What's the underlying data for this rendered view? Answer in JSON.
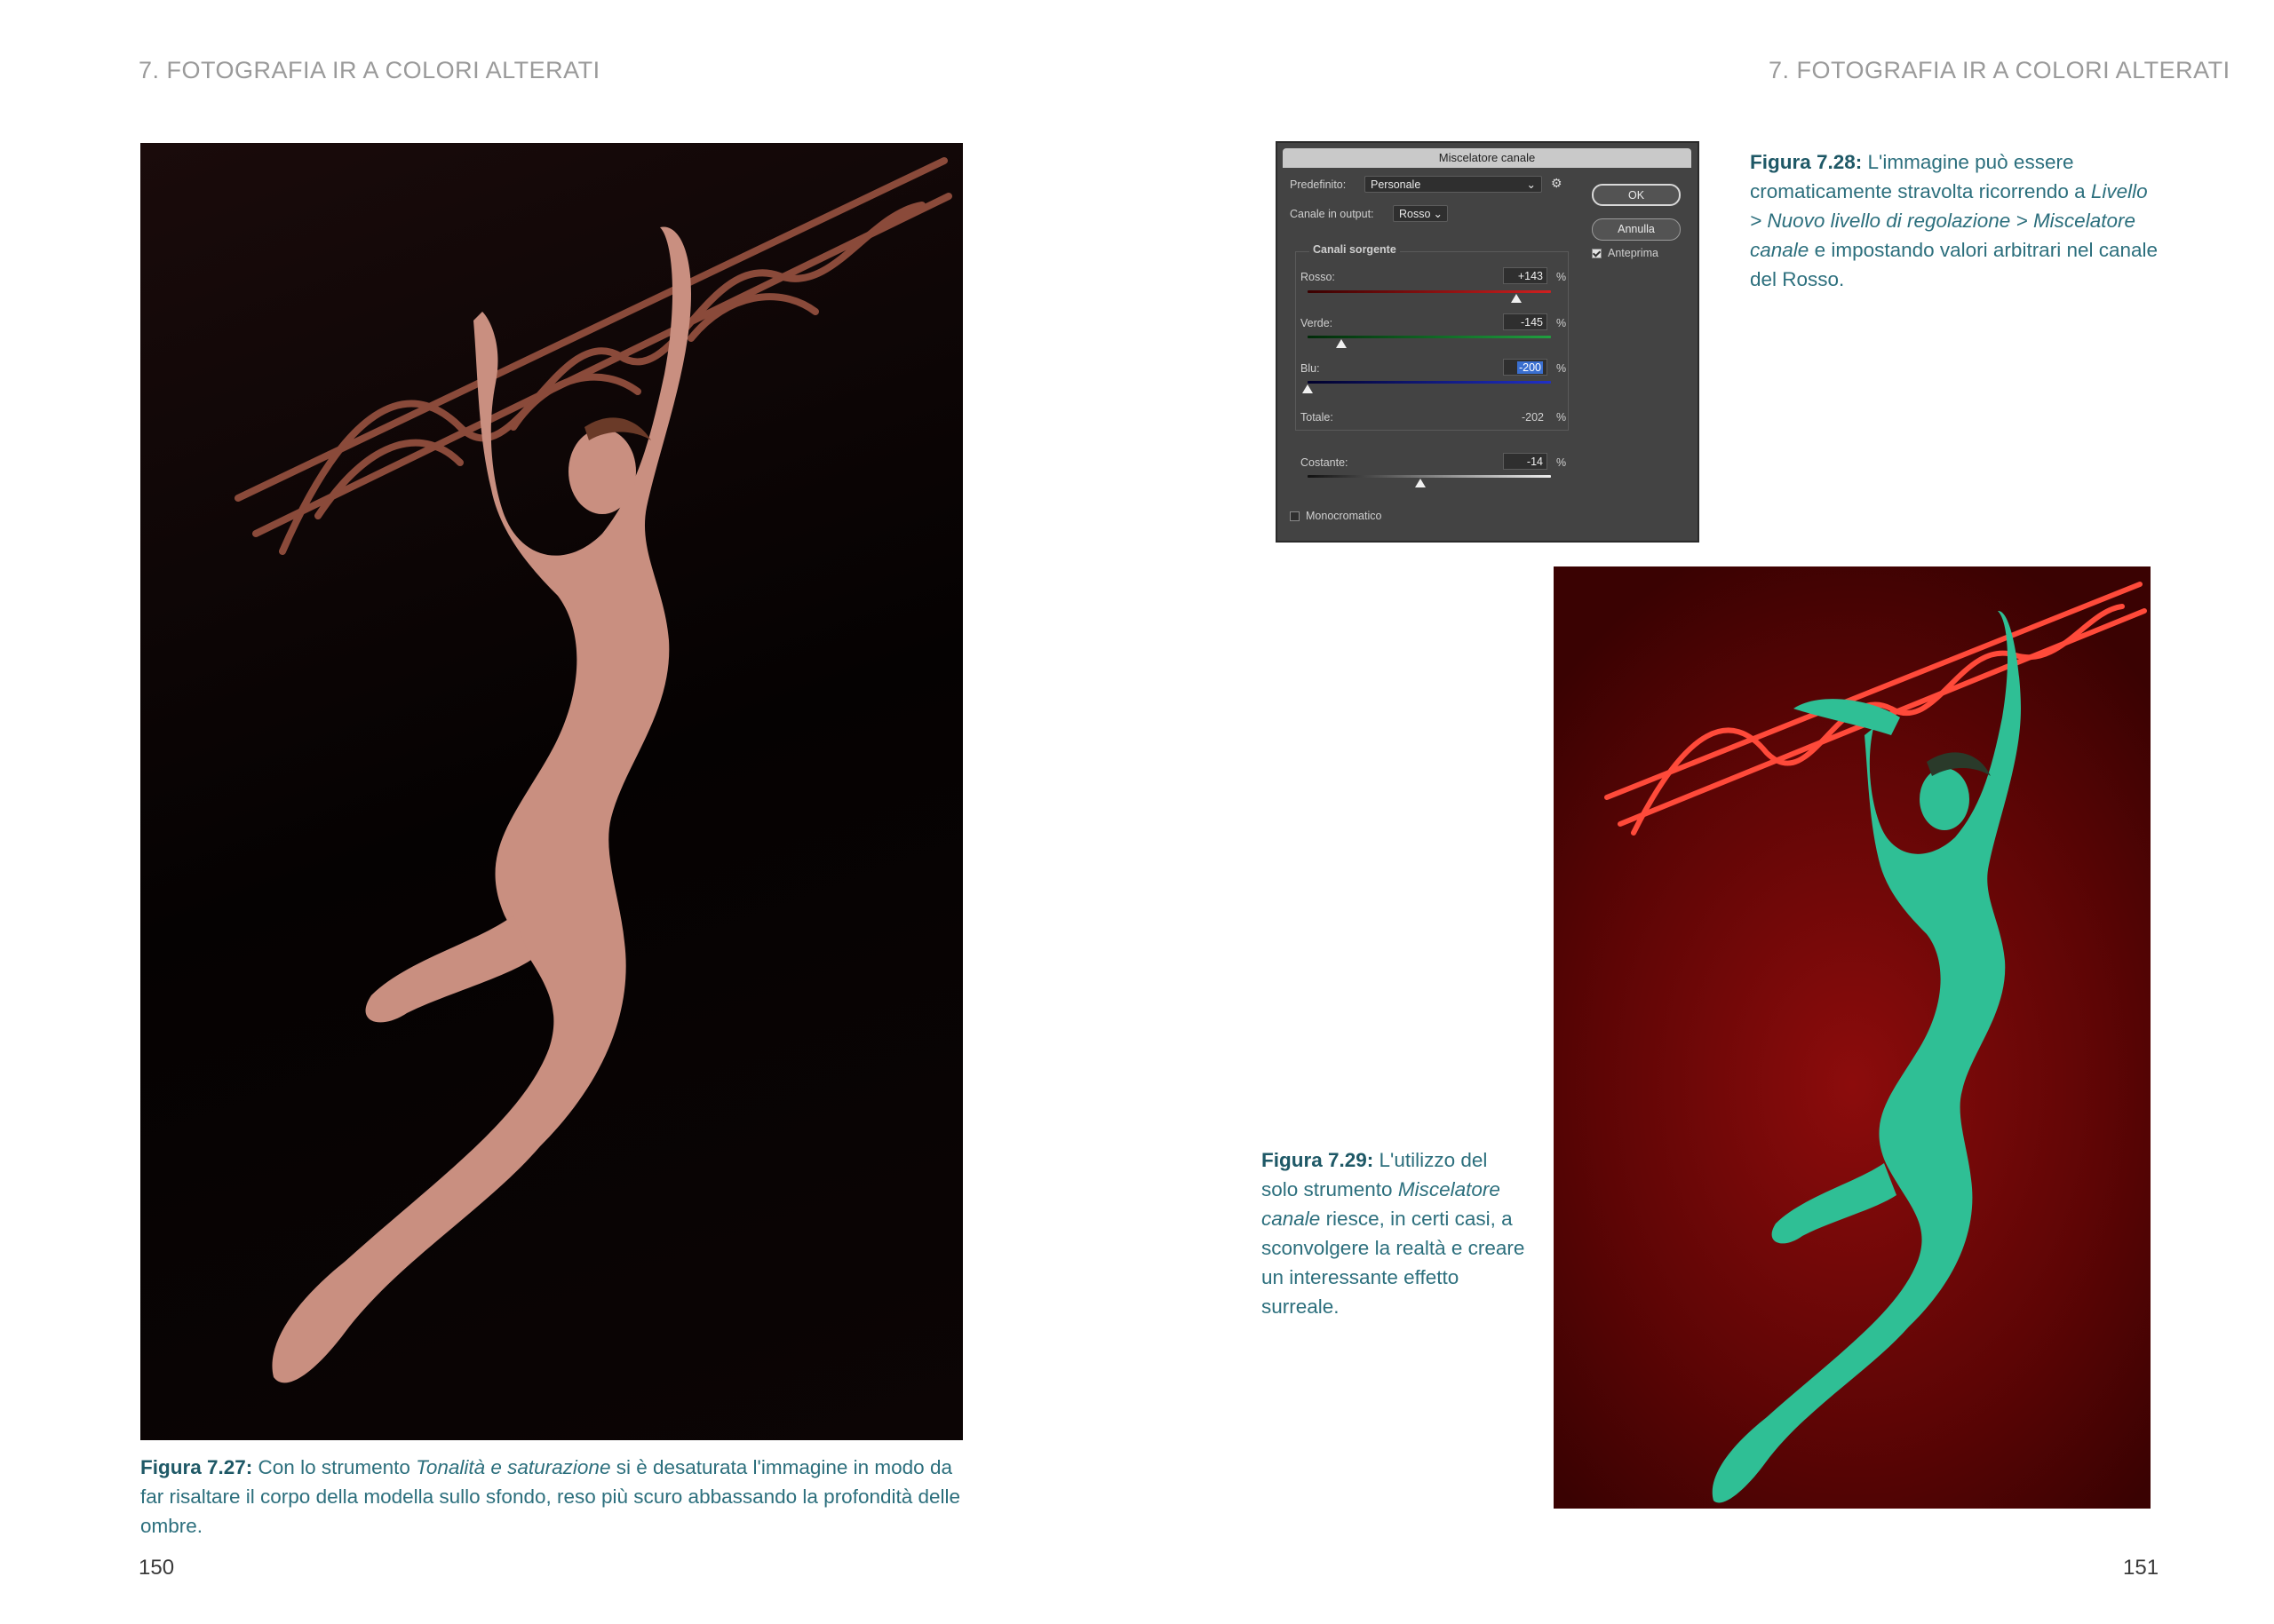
{
  "header": {
    "left": "7. FOTOGRAFIA IR A COLORI ALTERATI",
    "right": "7. FOTOGRAFIA IR A COLORI ALTERATI"
  },
  "page_numbers": {
    "left": "150",
    "right": "151"
  },
  "captions": {
    "fig_7_27": {
      "label": "Figura 7.27:",
      "t1": " Con lo strumento ",
      "i1": "Tonalità e saturazione",
      "t2": " si è desaturata l'immagine in modo da far risaltare il corpo della modella sullo sfondo, reso più scuro abbassando la profondità delle ombre."
    },
    "fig_7_28": {
      "label": "Figura 7.28:",
      "t1": " L'immagine può essere cromaticamente stravolta ricorrendo a ",
      "i1": "Livello > Nuovo livello di regolazione > Miscelatore canale",
      "t2": " e impostando valori arbitrari nel canale del Rosso."
    },
    "fig_7_29": {
      "label": "Figura 7.29:",
      "t1": " L'utilizzo del solo strumento ",
      "i1": "Miscelatore canale",
      "t2": " riesce, in certi casi, a sconvolgere la realtà e creare un interessante effetto surreale."
    }
  },
  "dialog": {
    "title": "Miscelatore canale",
    "preset_label": "Predefinito:",
    "preset_value": "Personale",
    "output_label": "Canale in output:",
    "output_value": "Rosso",
    "ok_label": "OK",
    "cancel_label": "Annulla",
    "preview_label": "Anteprima",
    "preview_checked": true,
    "source_group_label": "Canali sorgente",
    "channels": [
      {
        "label": "Rosso:",
        "value": "+143",
        "unit": "%",
        "slider_value": 143,
        "color": "#d02020"
      },
      {
        "label": "Verde:",
        "value": "-145",
        "unit": "%",
        "slider_value": -145,
        "color": "#20a040"
      },
      {
        "label": "Blu:",
        "value": "-200",
        "unit": "%",
        "slider_value": -200,
        "color": "#2030c8"
      }
    ],
    "total_label": "Totale:",
    "total_value": "-202",
    "total_unit": "%",
    "constant_label": "Costante:",
    "constant_value": "-14",
    "constant_unit": "%",
    "constant_slider_value": -14,
    "mono_label": "Monocromatico",
    "mono_checked": false,
    "colors": {
      "panel_bg": "#434343",
      "selection": "#3a6fd0"
    }
  },
  "photos": {
    "left_tone": "desaturated-warm",
    "right_tone": "channel-mixed-red-cyan"
  }
}
